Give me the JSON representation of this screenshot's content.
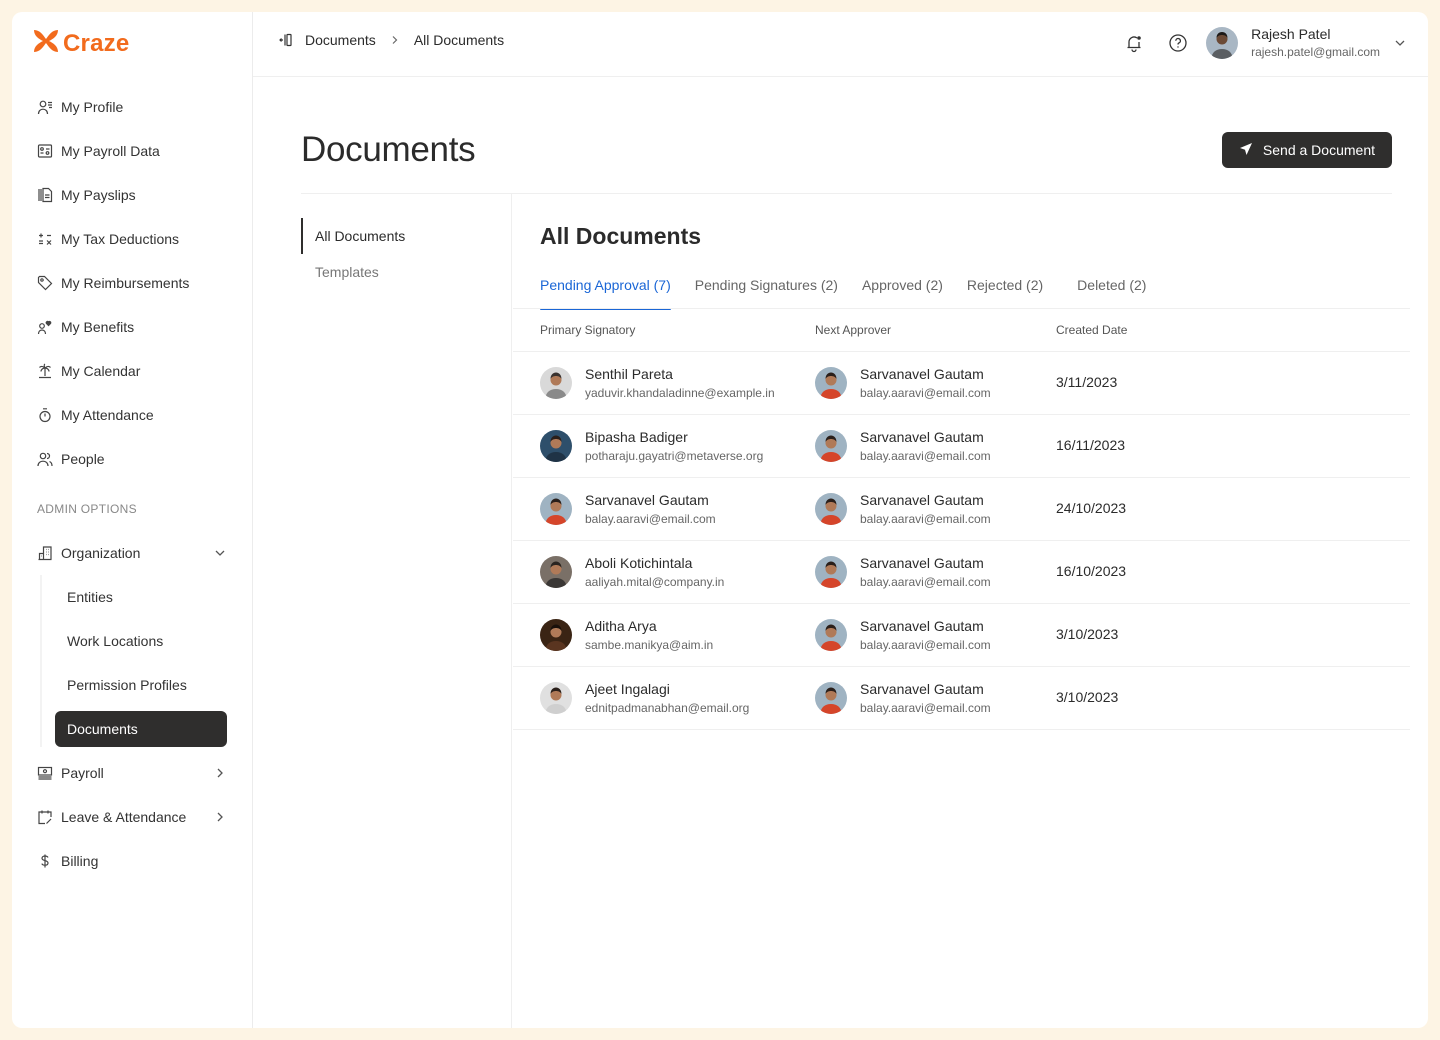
{
  "brand": {
    "name": "Craze",
    "color": "#f26b1d"
  },
  "sidebar": {
    "items": [
      {
        "label": "My Profile",
        "icon": "profile-icon"
      },
      {
        "label": "My Payroll Data",
        "icon": "payroll-data-icon"
      },
      {
        "label": "My Payslips",
        "icon": "payslips-icon"
      },
      {
        "label": "My Tax Deductions",
        "icon": "tax-icon"
      },
      {
        "label": "My Reimbursements",
        "icon": "tag-icon"
      },
      {
        "label": "My Benefits",
        "icon": "benefits-icon"
      },
      {
        "label": "My Calendar",
        "icon": "palm-tree-icon"
      },
      {
        "label": "My Attendance",
        "icon": "stopwatch-icon"
      },
      {
        "label": "People",
        "icon": "people-icon"
      }
    ],
    "admin_label": "ADMIN OPTIONS",
    "admin_items": [
      {
        "label": "Organization",
        "icon": "building-icon",
        "expanded": true,
        "children": [
          "Entities",
          "Work Locations",
          "Permission Profiles",
          "Documents"
        ],
        "active_child": "Documents"
      },
      {
        "label": "Payroll",
        "icon": "money-icon"
      },
      {
        "label": "Leave & Attendance",
        "icon": "calendar-edit-icon"
      },
      {
        "label": "Billing",
        "icon": "dollar-icon"
      }
    ]
  },
  "header": {
    "breadcrumb": [
      "Documents",
      "All Documents"
    ],
    "user": {
      "name": "Rajesh Patel",
      "email": "rajesh.patel@gmail.com"
    }
  },
  "page": {
    "title": "Documents",
    "send_button": "Send a Document",
    "subnav": [
      "All Documents",
      "Templates"
    ],
    "subnav_active": "All Documents",
    "content_title": "All Documents",
    "tabs": [
      {
        "label": "Pending Approval (7)",
        "active": true
      },
      {
        "label": "Pending Signatures (2)"
      },
      {
        "label": "Approved (2)"
      },
      {
        "label": "Rejected (2)"
      },
      {
        "label": "Deleted (2)"
      }
    ],
    "accent_color": "#1a66d6",
    "columns": [
      "Primary Signatory",
      "Next Approver",
      "Created Date"
    ],
    "rows": [
      {
        "signatory": {
          "name": "Senthil Pareta",
          "email": "yaduvir.khandaladinne@example.in"
        },
        "approver": {
          "name": "Sarvanavel Gautam",
          "email": "balay.aaravi@email.com"
        },
        "date": "3/11/2023"
      },
      {
        "signatory": {
          "name": "Bipasha Badiger",
          "email": "potharaju.gayatri@metaverse.org"
        },
        "approver": {
          "name": "Sarvanavel Gautam",
          "email": "balay.aaravi@email.com"
        },
        "date": "16/11/2023"
      },
      {
        "signatory": {
          "name": "Sarvanavel Gautam",
          "email": "balay.aaravi@email.com"
        },
        "approver": {
          "name": "Sarvanavel Gautam",
          "email": "balay.aaravi@email.com"
        },
        "date": "24/10/2023"
      },
      {
        "signatory": {
          "name": "Aboli Kotichintala",
          "email": "aaliyah.mital@company.in"
        },
        "approver": {
          "name": "Sarvanavel Gautam",
          "email": "balay.aaravi@email.com"
        },
        "date": "16/10/2023"
      },
      {
        "signatory": {
          "name": "Aditha Arya",
          "email": "sambe.manikya@aim.in"
        },
        "approver": {
          "name": "Sarvanavel Gautam",
          "email": "balay.aaravi@email.com"
        },
        "date": "3/10/2023"
      },
      {
        "signatory": {
          "name": "Ajeet Ingalagi",
          "email": "ednitpadmanabhan@email.org"
        },
        "approver": {
          "name": "Sarvanavel Gautam",
          "email": "balay.aaravi@email.com"
        },
        "date": "3/10/2023"
      }
    ]
  }
}
